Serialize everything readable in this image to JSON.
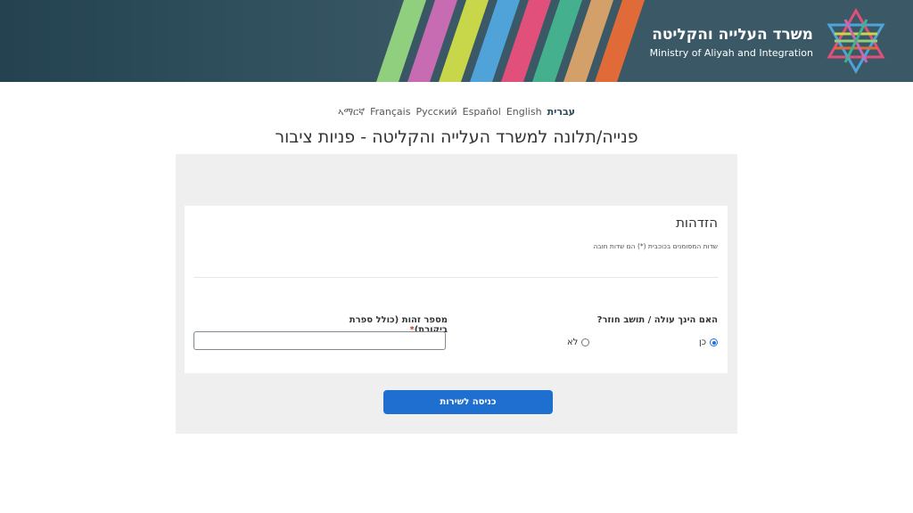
{
  "header": {
    "ministry_he": "משרד העלייה והקליטה",
    "ministry_en": "Ministry of Aliyah and Integration",
    "colors": {
      "background": "#3b5866",
      "stripes": [
        "#8fcf7d",
        "#c76bb3",
        "#c8d64a",
        "#4fa3d9",
        "#e0507a",
        "#45b08e",
        "#d4a06a",
        "#e06a38"
      ]
    }
  },
  "languages": [
    {
      "label": "ኣማርኛ",
      "active": false
    },
    {
      "label": "Français",
      "active": false
    },
    {
      "label": "Русский",
      "active": false
    },
    {
      "label": "Español",
      "active": false
    },
    {
      "label": "English",
      "active": false
    },
    {
      "label": "עברית",
      "active": true
    }
  ],
  "page_title": "פנייה/תלונה למשרד העלייה והקליטה - פניות ציבור",
  "form": {
    "section_title": "הזדהות",
    "required_note": "שדות המסומנים בכוכבית (*) הם שדות חובה",
    "question_label": "האם הינך עולה / תושב חוזר?",
    "option_yes": "כן",
    "option_no": "לא",
    "selected": "yes",
    "id_label": "מספר זהות (כולל ספרת ביקורת)",
    "required_mark": "*",
    "id_value": ""
  },
  "submit_label": "כניסה לשירות",
  "accent_color": "#1f6fd1"
}
